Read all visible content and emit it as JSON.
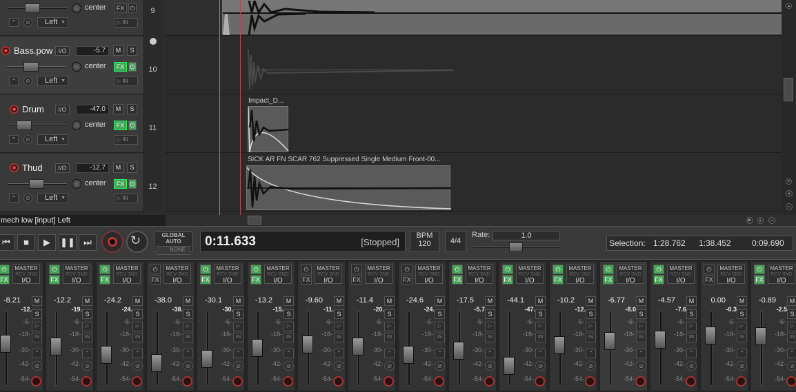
{
  "tracks": [
    {
      "number": "9",
      "name": "",
      "volume": "",
      "pan": "center",
      "input": "Left",
      "fx_on": false,
      "in_label": "IN",
      "show_header": false
    },
    {
      "number": "10",
      "name": "Bass.pow",
      "volume": "-5.7",
      "pan": "center",
      "input": "Left",
      "fx_on": true,
      "in_label": "IN",
      "show_header": true
    },
    {
      "number": "11",
      "name": "Drum",
      "volume": "-47.0",
      "pan": "center",
      "input": "Left",
      "fx_on": true,
      "in_label": "IN",
      "show_header": true
    },
    {
      "number": "12",
      "name": "Thud",
      "volume": "-12.7",
      "pan": "center",
      "input": "Left",
      "fx_on": true,
      "in_label": "IN",
      "show_header": true
    }
  ],
  "track_labels": {
    "io": "I/O",
    "mute": "M",
    "solo": "S",
    "fx": "FX",
    "power": "⏻"
  },
  "items": [
    {
      "label": "Impact_D..."
    },
    {
      "label": "SICK AR FN SCAR 762 Suppressed Single Medium Front-00..."
    }
  ],
  "status_line": "mech low [input] Left",
  "transport": {
    "global_auto": "GLOBAL AUTO",
    "global_auto_value": "NONE",
    "time": "0:11.633",
    "state": "[Stopped]",
    "bpm_label": "BPM",
    "bpm": "120",
    "time_sig": "4/4",
    "rate_label": "Rate:",
    "rate": "1.0",
    "selection_label": "Selection:",
    "selection_start": "1:28.762",
    "selection_end": "1:38.452",
    "selection_length": "0:09.690"
  },
  "mixer": {
    "master_label": "MASTER",
    "rcv_label": "RCV SND",
    "io_label": "I/O",
    "fx_label": "FX",
    "mute": "M",
    "solo": "S",
    "in_label": "IN",
    "scale": [
      "-6-",
      "-18-",
      "-30-",
      "-42-",
      "-54-"
    ],
    "strips": [
      {
        "vol": "-8.21",
        "peak": "-12.",
        "fx_on": true,
        "fader": 0.42
      },
      {
        "vol": "-12.2",
        "peak": "-19.",
        "fx_on": true,
        "fader": 0.48
      },
      {
        "vol": "-24.2",
        "peak": "-24.",
        "fx_on": true,
        "fader": 0.62
      },
      {
        "vol": "-38.0",
        "peak": "-38.",
        "fx_on": false,
        "fader": 0.78
      },
      {
        "vol": "-30.1",
        "peak": "-30.",
        "fx_on": true,
        "fader": 0.7
      },
      {
        "vol": "-13.2",
        "peak": "-15.",
        "fx_on": true,
        "fader": 0.5
      },
      {
        "vol": "-9.60",
        "peak": "-11.",
        "fx_on": false,
        "fader": 0.44
      },
      {
        "vol": "-11.4",
        "peak": "-20.",
        "fx_on": false,
        "fader": 0.47
      },
      {
        "vol": "-24.6",
        "peak": "-24.",
        "fx_on": false,
        "fader": 0.63
      },
      {
        "vol": "-17.5",
        "peak": "-5.7",
        "fx_on": true,
        "fader": 0.55
      },
      {
        "vol": "-44.1",
        "peak": "-47.",
        "fx_on": true,
        "fader": 0.82
      },
      {
        "vol": "-10.2",
        "peak": "-12.",
        "fx_on": true,
        "fader": 0.45
      },
      {
        "vol": "-6.77",
        "peak": "-8.0",
        "fx_on": true,
        "fader": 0.38
      },
      {
        "vol": "-4.57",
        "peak": "-7.6",
        "fx_on": true,
        "fader": 0.35
      },
      {
        "vol": "0.00",
        "peak": "-0.3",
        "fx_on": false,
        "fader": 0.27
      },
      {
        "vol": "-0.89",
        "peak": "-2.5",
        "fx_on": true,
        "fader": 0.29
      }
    ]
  }
}
